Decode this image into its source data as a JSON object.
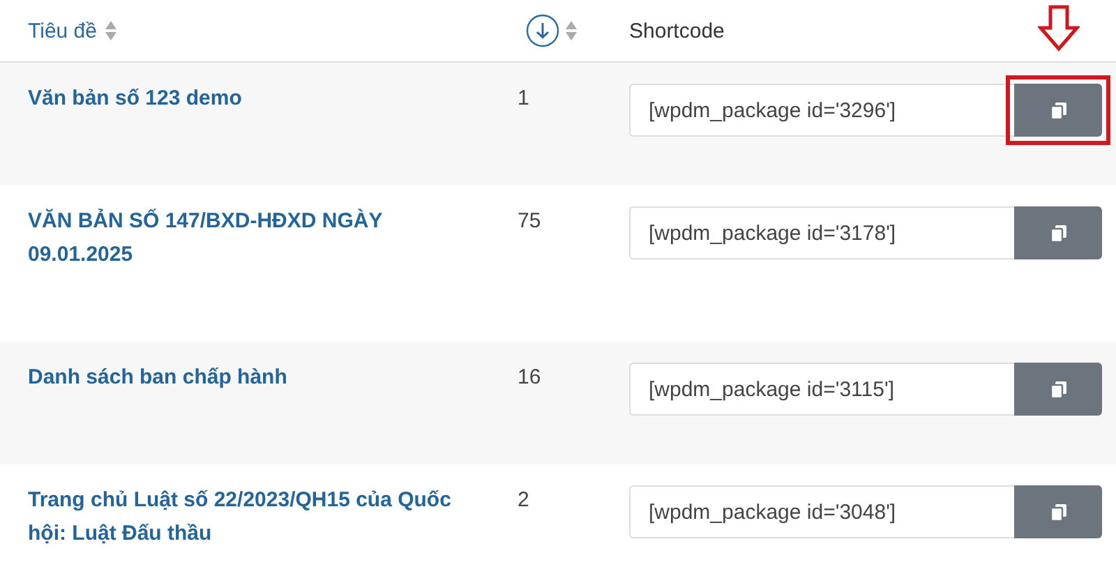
{
  "table": {
    "columns": [
      {
        "label": "Tiêu đề",
        "kind": "sort"
      },
      {
        "kind": "download-sort"
      },
      {
        "label": "Shortcode",
        "kind": "plain"
      }
    ],
    "rows": [
      {
        "title": "Văn bản số 123 demo",
        "count": "1",
        "shortcode": "[wpdm_package id='3296']",
        "highlighted": true
      },
      {
        "title": "VĂN BẢN SỐ 147/BXD-HĐXD NGÀY 09.01.2025",
        "count": "75",
        "shortcode": "[wpdm_package id='3178']",
        "highlighted": false
      },
      {
        "title": "Danh sách ban chấp hành",
        "count": "16",
        "shortcode": "[wpdm_package id='3115']",
        "highlighted": false
      },
      {
        "title": "Trang chủ Luật số 22/2023/QH15 của Quốc hội: Luật Đấu thầu",
        "count": "2",
        "shortcode": "[wpdm_package id='3048']",
        "highlighted": false
      }
    ]
  }
}
